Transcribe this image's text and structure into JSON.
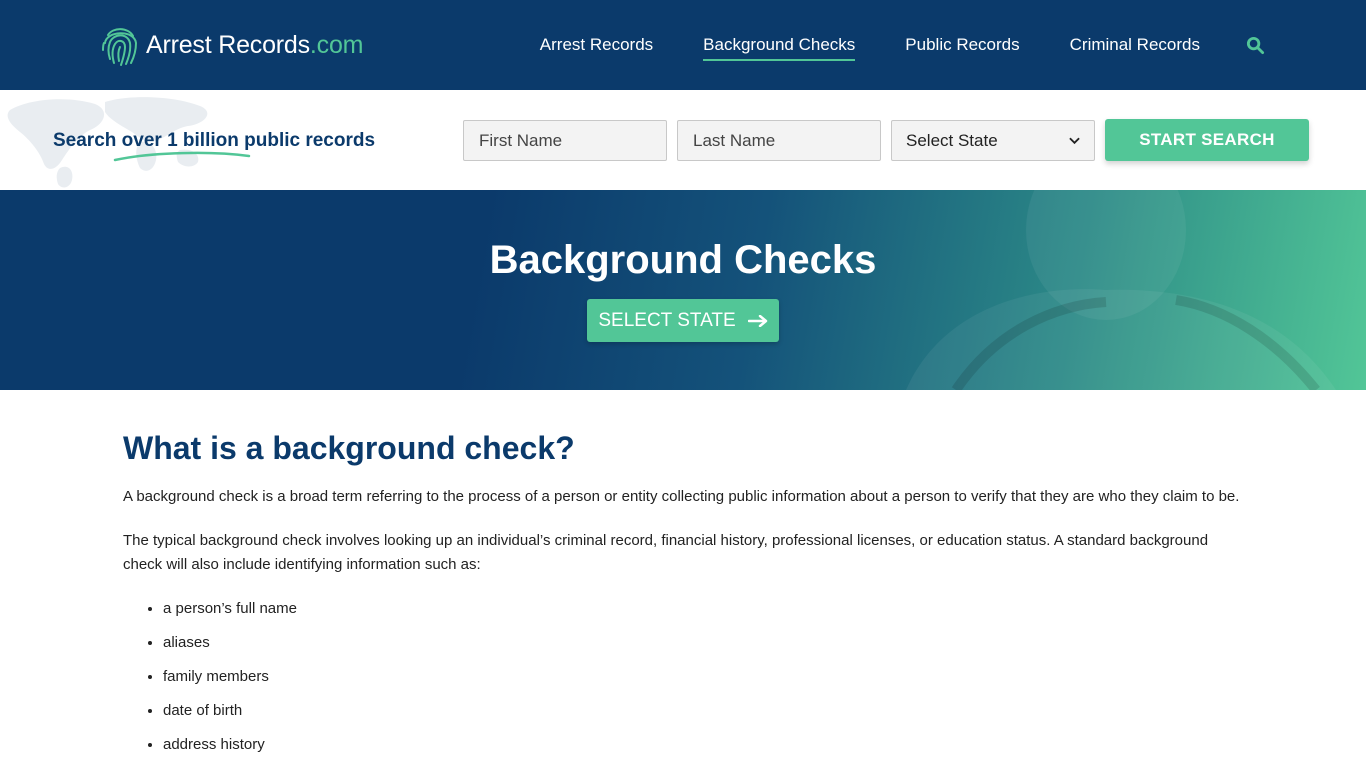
{
  "header": {
    "logo": {
      "main": "Arrest Records",
      "tld": ".com"
    },
    "nav": [
      {
        "label": "Arrest Records",
        "active": false
      },
      {
        "label": "Background Checks",
        "active": true
      },
      {
        "label": "Public Records",
        "active": false
      },
      {
        "label": "Criminal Records",
        "active": false
      }
    ],
    "search_icon": "search-icon"
  },
  "searchbar": {
    "tagline": "Search over 1 billion public records",
    "first_name_placeholder": "First Name",
    "last_name_placeholder": "Last Name",
    "state_select": "Select State",
    "button": "START SEARCH"
  },
  "hero": {
    "title": "Background Checks",
    "button": "SELECT STATE",
    "button_icon": "arrow-right-icon"
  },
  "content": {
    "heading": "What is a background check?",
    "para1": "A background check is a broad term referring to the process of a person or entity collecting public information about a person to verify that they are who they claim to be.",
    "para2": "The typical background check involves looking up an individual’s criminal record, financial history, professional licenses, or education status. A standard background check will also include identifying information such as:",
    "list": [
      "a person’s full name",
      "aliases",
      "family members",
      "date of birth",
      "address history"
    ]
  },
  "colors": {
    "primary": "#0b3a6b",
    "accent": "#52c697"
  }
}
